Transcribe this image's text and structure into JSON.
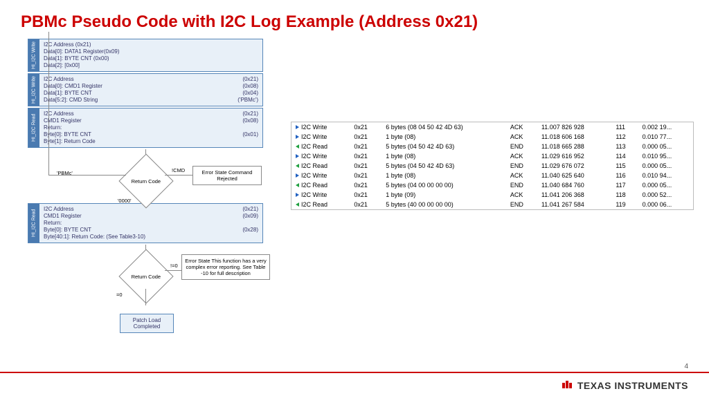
{
  "title": "PBMc Pseudo Code with I2C Log Example (Address 0x21)",
  "page_number": "4",
  "logo_text": "TEXAS INSTRUMENTS",
  "flow": {
    "blocks": [
      {
        "tab": "HI_I2C Write",
        "lines": [
          {
            "l": "I2C Address (0x21)",
            "r": ""
          },
          {
            "l": "Data[0]: DATA1 Register(0x09)",
            "r": ""
          },
          {
            "l": "Data[1]: BYTE CNT (0x00)",
            "r": ""
          },
          {
            "l": "Data[2]: [0x00]",
            "r": ""
          }
        ]
      },
      {
        "tab": "HI_I2C Write",
        "lines": [
          {
            "l": "I2C Address",
            "r": "(0x21)"
          },
          {
            "l": "Data[0]: CMD1 Register",
            "r": "(0x08)"
          },
          {
            "l": "Data[1]: BYTE CNT",
            "r": "(0x04)"
          },
          {
            "l": "Data[5:2]: CMD String",
            "r": "('PBMc')"
          }
        ]
      },
      {
        "tab": "HI_I2C Read",
        "lines": [
          {
            "l": "I2C Address",
            "r": "(0x21)"
          },
          {
            "l": "CMD1 Register",
            "r": "(0x08)"
          },
          {
            "l": "Return:",
            "r": ""
          },
          {
            "l": "Byte[0]: BYTE CNT",
            "r": "(0x01)"
          },
          {
            "l": "Byte[1]: Return Code",
            "r": ""
          }
        ]
      },
      {
        "tab": "HI_I2C Read",
        "lines": [
          {
            "l": "I2C Address",
            "r": "(0x21)"
          },
          {
            "l": "CMD1 Register",
            "r": "(0x09)"
          },
          {
            "l": "Return:",
            "r": ""
          },
          {
            "l": "Byte[0]: BYTE CNT",
            "r": "(0x28)"
          },
          {
            "l": "Byte[40:1]: Return Code: (See Table3-10)",
            "r": ""
          }
        ]
      }
    ],
    "diamond1": "Return Code",
    "diamond1_left": "'PBMc'",
    "diamond1_right": "!CMD",
    "diamond1_mid": "'0000'",
    "err1": "Error State\nCommand Rejected",
    "diamond2": "Return Code",
    "diamond2_right": "!=0",
    "diamond2_down": "=0",
    "err2": "Error State\nThis function has a very complex error reporting. See Table -10 for full description",
    "patch": "Patch Load Completed"
  },
  "log": {
    "rows": [
      {
        "dir": "w",
        "op": "I2C Write",
        "addr": "0x21",
        "data": "6 bytes (08 04 50 42 4D 63)",
        "ack": "ACK",
        "ts": "11.007 826 928",
        "n": "111",
        "d": "0.002 19..."
      },
      {
        "dir": "w",
        "op": "I2C Write",
        "addr": "0x21",
        "data": "1 byte (08)",
        "ack": "ACK",
        "ts": "11.018 606 168",
        "n": "112",
        "d": "0.010 77..."
      },
      {
        "dir": "r",
        "op": "I2C Read",
        "addr": "0x21",
        "data": "5 bytes (04 50 42 4D 63)",
        "ack": "END",
        "ts": "11.018 665 288",
        "n": "113",
        "d": "0.000 05..."
      },
      {
        "dir": "w",
        "op": "I2C Write",
        "addr": "0x21",
        "data": "1 byte (08)",
        "ack": "ACK",
        "ts": "11.029 616 952",
        "n": "114",
        "d": "0.010 95..."
      },
      {
        "dir": "r",
        "op": "I2C Read",
        "addr": "0x21",
        "data": "5 bytes (04 50 42 4D 63)",
        "ack": "END",
        "ts": "11.029 676 072",
        "n": "115",
        "d": "0.000 05..."
      },
      {
        "dir": "w",
        "op": "I2C Write",
        "addr": "0x21",
        "data": "1 byte (08)",
        "ack": "ACK",
        "ts": "11.040 625 640",
        "n": "116",
        "d": "0.010 94..."
      },
      {
        "dir": "r",
        "op": "I2C Read",
        "addr": "0x21",
        "data": "5 bytes (04 00 00 00 00)",
        "ack": "END",
        "ts": "11.040 684 760",
        "n": "117",
        "d": "0.000 05..."
      },
      {
        "dir": "w",
        "op": "I2C Write",
        "addr": "0x21",
        "data": "1 byte (09)",
        "ack": "ACK",
        "ts": "11.041 206 368",
        "n": "118",
        "d": "0.000 52..."
      },
      {
        "dir": "r",
        "op": "I2C Read",
        "addr": "0x21",
        "data": "5 bytes (40 00 00 00 00)",
        "ack": "END",
        "ts": "11.041 267 584",
        "n": "119",
        "d": "0.000 06..."
      }
    ]
  }
}
